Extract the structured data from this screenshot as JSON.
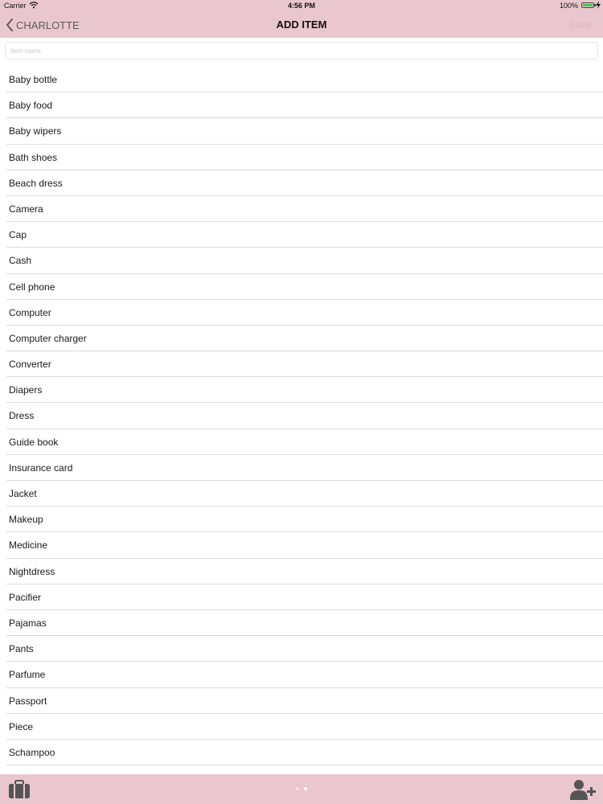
{
  "status_bar": {
    "carrier": "Carrier",
    "time": "4:56 PM",
    "battery": "100%",
    "wifi_icon": "wifi-icon",
    "battery_icon": "battery-icon",
    "charging_icon": "charging-icon"
  },
  "nav": {
    "back_label": "CHARLOTTE",
    "back_icon": "chevron-left-icon",
    "title": "ADD ITEM",
    "save_label": "Save"
  },
  "search": {
    "placeholder": "Item name",
    "value": ""
  },
  "items": [
    "Baby bottle",
    "Baby food",
    "Baby wipers",
    "Bath shoes",
    "Beach dress",
    "Camera",
    "Cap",
    "Cash",
    "Cell phone",
    "Computer",
    "Computer charger",
    "Converter",
    "Diapers",
    "Dress",
    "Guide book",
    "Insurance card",
    "Jacket",
    "Makeup",
    "Medicine",
    "Nightdress",
    "Pacifier",
    "Pajamas",
    "Pants",
    "Parfume",
    "Passport",
    "Piece",
    "Schampoo"
  ],
  "bottom_bar": {
    "left_icon": "suitcase-icon",
    "right_icon": "add-user-icon",
    "page_count": 2,
    "active_page": 2
  },
  "colors": {
    "bar_background": "#eac7cf",
    "save_disabled": "#d9b4bc",
    "separator": "#dcdcdc"
  }
}
